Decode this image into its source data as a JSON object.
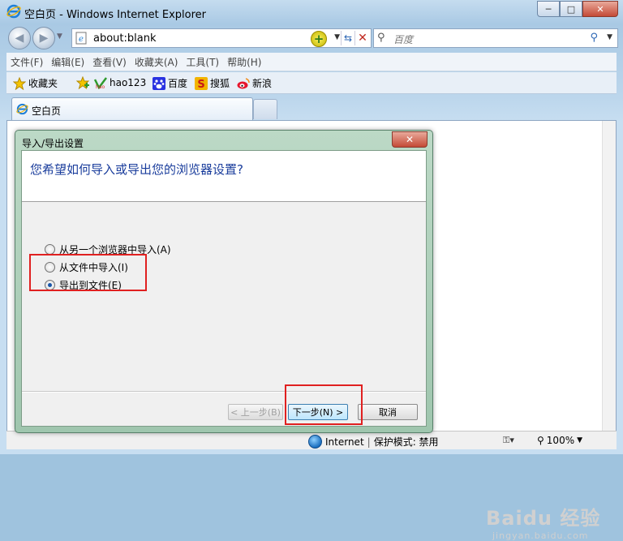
{
  "window": {
    "title": "空白页 - Windows Internet Explorer",
    "minimize": "─",
    "maximize": "□",
    "close": "✕"
  },
  "nav": {
    "back": "◀",
    "forward": "▶",
    "address": "about:blank",
    "search_placeholder": "百度"
  },
  "menu": [
    "文件(F)",
    "编辑(E)",
    "查看(V)",
    "收藏夹(A)",
    "工具(T)",
    "帮助(H)"
  ],
  "favorites": {
    "label": "收藏夹",
    "items": [
      "hao123",
      "百度",
      "搜狐",
      "新浪"
    ]
  },
  "tabs": [
    {
      "label": "空白页"
    }
  ],
  "dialog": {
    "title": "导入/导出设置",
    "close": "✕",
    "question": "您希望如何导入或导出您的浏览器设置?",
    "options": [
      {
        "label": "从另一个浏览器中导入(A)",
        "selected": false
      },
      {
        "label": "从文件中导入(I)",
        "selected": false
      },
      {
        "label": "导出到文件(E)",
        "selected": true
      }
    ],
    "buttons": {
      "back": "< 上一步(B)",
      "next": "下一步(N) >",
      "cancel": "取消"
    }
  },
  "status": {
    "zone": "Internet",
    "separator": "|",
    "protected_mode": "保护模式: 禁用",
    "zoom": "100%"
  },
  "watermark": {
    "brand": "Baidu 经验",
    "url": "jingyan.baidu.com"
  },
  "colors": {
    "dialog_frame": "#9fc6ae",
    "question_text": "#1a3d9c",
    "highlight_box": "#e02020"
  }
}
